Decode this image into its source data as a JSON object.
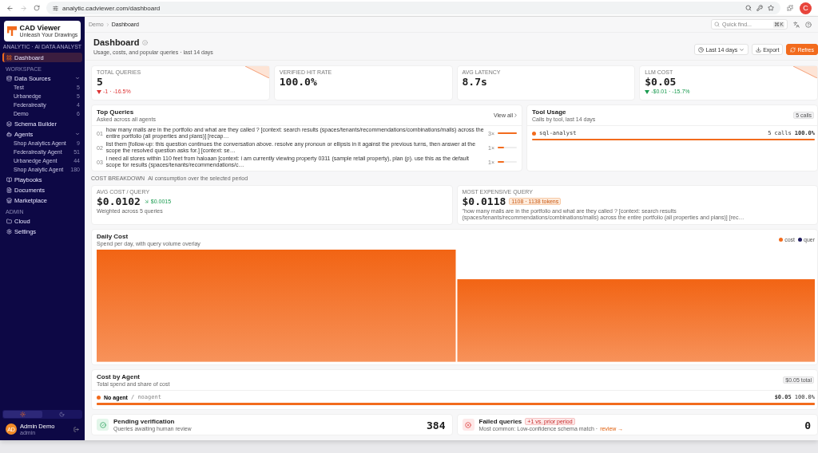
{
  "browser": {
    "url": "analytic.cadviewer.com/dashboard",
    "profile": "C"
  },
  "sidebar": {
    "logo": {
      "title": "CAD Viewer",
      "tagline": "Unleash Your Drawings"
    },
    "subtitle": "ANALYTIC · AI DATA ANALYST",
    "top": [
      {
        "label": "Dashboard",
        "selected": true
      }
    ],
    "sections": [
      {
        "heading": "WORKSPACE",
        "items": [
          {
            "label": "Data Sources",
            "selected": false,
            "expanded": true,
            "children": [
              {
                "label": "Test",
                "count": "5"
              },
              {
                "label": "Urbanedge",
                "count": "5"
              },
              {
                "label": "Federalrealty",
                "count": "4"
              },
              {
                "label": "Demo",
                "count": "6"
              }
            ]
          },
          {
            "label": "Schema Builder",
            "selected": false
          },
          {
            "label": "Agents",
            "selected": false,
            "expanded": true,
            "children": [
              {
                "label": "Shop Analytics Agent",
                "count": "9"
              },
              {
                "label": "Federalrealty Agent",
                "count": "51"
              },
              {
                "label": "Urbanedge Agent",
                "count": "44"
              },
              {
                "label": "Shop Analytic Agent",
                "count": "180"
              }
            ]
          },
          {
            "label": "Playbooks",
            "selected": false
          },
          {
            "label": "Documents",
            "selected": false
          },
          {
            "label": "Marketplace",
            "selected": false
          }
        ]
      },
      {
        "heading": "ADMIN",
        "items": [
          {
            "label": "Cloud",
            "selected": false
          },
          {
            "label": "Settings",
            "selected": false
          }
        ]
      }
    ],
    "theme": [
      {
        "selected": true
      },
      {
        "selected": false
      }
    ],
    "user": {
      "initials": "AD",
      "name": "Admin Demo",
      "role": "admin"
    }
  },
  "topbar": {
    "breadcrumb": [
      "Demo",
      "Dashboard"
    ],
    "search": {
      "placeholder": "Quick find...",
      "shortcut": "⌘K"
    }
  },
  "header": {
    "title": "Dashboard",
    "subtitle": "Usage, costs, and popular queries · last 14 days",
    "range": "Last 14 days",
    "export": "Export",
    "refresh": "Refres"
  },
  "stats": [
    {
      "label": "TOTAL QUERIES",
      "value": "5",
      "delta": "-1 · -16.5%",
      "color": "#dd3333",
      "sparkline": true
    },
    {
      "label": "VERIFIED HIT RATE",
      "value": "100.0%",
      "sparkline": false
    },
    {
      "label": "AVG LATENCY",
      "value": "8.7s",
      "sparkline": false
    },
    {
      "label": "LLM COST",
      "value": "$0.05",
      "delta": "-$0.01 · -15.7%",
      "color": "#1a9b50",
      "sparkline": true
    }
  ],
  "top_queries": {
    "title": "Top Queries",
    "subtitle": "Asked across all agents",
    "link": "View all",
    "rows": [
      {
        "index": "01",
        "text": "how many malls are in the portfolio and what are they called ? [context: search results (spaces/tenants/recommendations/combinations/malls) across the entire portfolio (all properties and plans)] [recap…",
        "count": "3×",
        "level": 1
      },
      {
        "index": "02",
        "text": "list them [follow-up: this question continues the conversation above. resolve any pronoun or ellipsis in it against the previous turns, then answer at the scope the resolved question asks for.] [context: se…",
        "count": "1×",
        "level": 0.33
      },
      {
        "index": "03",
        "text": "i need all stores within 110 feet from haloaan [context: i am currently viewing property 0311 (sample retail property), plan (p). use this as the default scope for results (spaces/tenants/recommendations/c…",
        "count": "1×",
        "level": 0.33
      }
    ]
  },
  "tool_usage": {
    "title": "Tool Usage",
    "subtitle": "Calls by tool, last 14 days",
    "badge": "5 calls",
    "rows": [
      {
        "name": "sql-analyst",
        "calls": "5 calls",
        "share": "100.0%",
        "level": 1
      }
    ]
  },
  "cost_breakdown": {
    "heading": "COST BREAKDOWN",
    "note": "AI consumption over the selected period",
    "avg": {
      "label": "AVG COST / QUERY",
      "value": "$0.0102",
      "delta": "$0.0015",
      "note": "Weighted across 5 queries"
    },
    "max": {
      "label": "MOST EXPENSIVE QUERY",
      "value": "$0.0118",
      "badge": "1108 · 1138 tokens",
      "text": "\"how many malls are in the portfolio and what are they called ? [context: search results (spaces/tenants/recommendations/combinations/malls) across the entire portfolio (all properties and plans)] [rec…"
    }
  },
  "daily_cost": {
    "title": "Daily Cost",
    "subtitle": "Spend per day, with query volume overlay",
    "legend": [
      {
        "label": "cost",
        "color": "#f26b1d"
      },
      {
        "label": "quer",
        "color": "#1e1b5e"
      }
    ]
  },
  "cost_by_agent": {
    "title": "Cost by Agent",
    "subtitle": "Total spend and share of cost",
    "badge": "$0.05 total",
    "rows": [
      {
        "name": "No agent",
        "slug": "/ noagent",
        "cost": "$0.05",
        "share": "100.0%",
        "level": 1
      }
    ]
  },
  "alerts": [
    {
      "kind": "pending",
      "title": "Pending verification",
      "text": "Queries awaiting human review",
      "value": "384"
    },
    {
      "kind": "failed",
      "title": "Failed queries",
      "badge": "+1 vs. prior period",
      "text": "Most common: Low-confidence schema match ·",
      "link": "review →",
      "value": "0"
    }
  ]
}
